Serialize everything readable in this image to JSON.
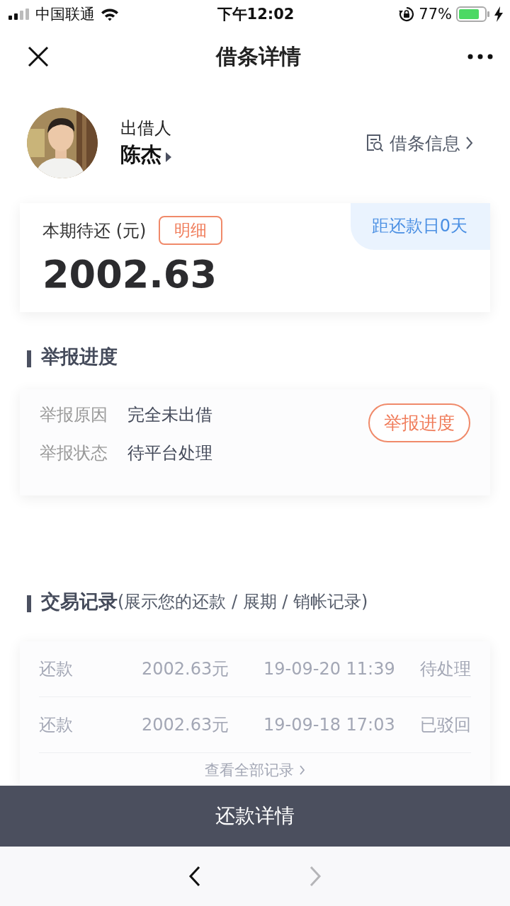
{
  "status_bar": {
    "carrier": "中国联通",
    "time": "下午12:02",
    "battery": "77%"
  },
  "nav": {
    "title": "借条详情"
  },
  "lender": {
    "role": "出借人",
    "name": "陈杰",
    "info_link": "借条信息"
  },
  "due_card": {
    "label": "本期待还 (元)",
    "detail_button": "明细",
    "amount": "2002.63",
    "countdown": "距还款日0天"
  },
  "report": {
    "title": "举报进度",
    "fields": [
      {
        "label": "举报原因",
        "value": "完全未出借"
      },
      {
        "label": "举报状态",
        "value": "待平台处理"
      }
    ],
    "button": "举报进度"
  },
  "records": {
    "title": "交易记录",
    "subtitle": "(展示您的还款 / 展期 / 销帐记录)",
    "rows": [
      {
        "type": "还款",
        "amount": "2002.63元",
        "time": "19-09-20 11:39",
        "status": "待处理"
      },
      {
        "type": "还款",
        "amount": "2002.63元",
        "time": "19-09-18 17:03",
        "status": "已驳回"
      }
    ],
    "view_all": "查看全部记录"
  },
  "action_button": "还款详情",
  "browser_nav": {
    "back_disabled": false,
    "forward_disabled": true
  }
}
